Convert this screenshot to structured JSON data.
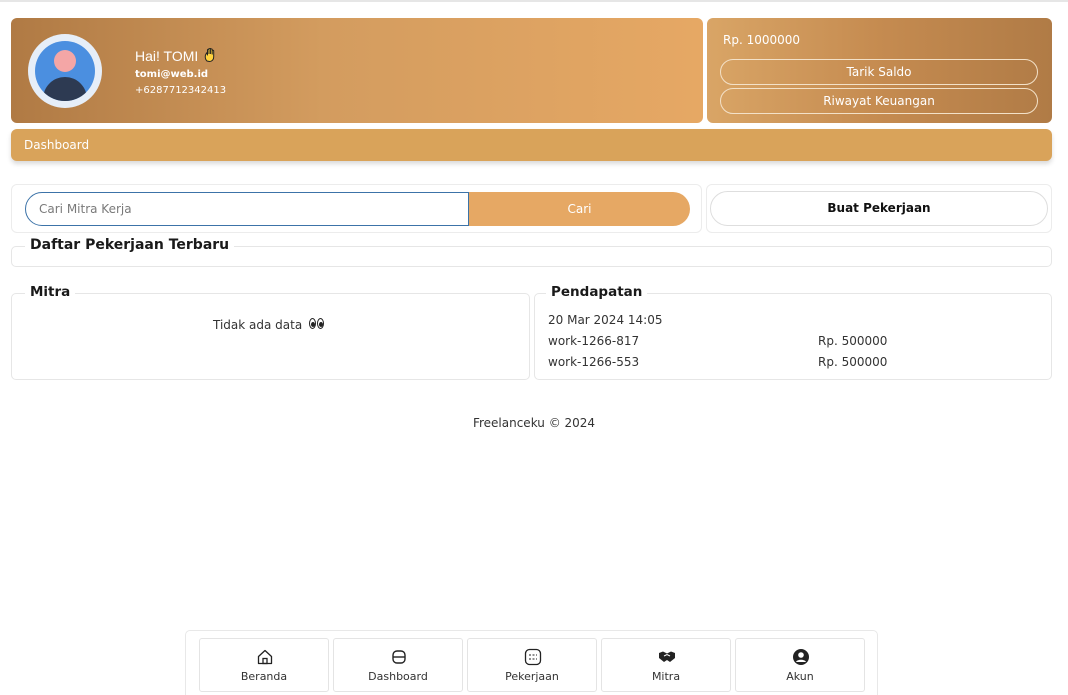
{
  "profile": {
    "greeting": "Hai! TOMI",
    "wave_icon": "waving-hand-icon",
    "email": "tomi@web.id",
    "phone": "+6287712342413"
  },
  "balance": {
    "amount": "Rp. 1000000",
    "withdraw_label": "Tarik Saldo",
    "history_label": "Riwayat Keuangan"
  },
  "breadcrumb": {
    "title": "Dashboard"
  },
  "search": {
    "placeholder": "Cari Mitra Kerja",
    "button_label": "Cari",
    "create_job_label": "Buat Pekerjaan"
  },
  "jobs": {
    "title": "Daftar Pekerjaan Terbaru"
  },
  "mitra": {
    "title": "Mitra",
    "empty_text": "Tidak ada data"
  },
  "income": {
    "title": "Pendapatan",
    "date": "20 Mar 2024 14:05",
    "rows": [
      {
        "work": "work-1266-817",
        "amount": "Rp. 500000"
      },
      {
        "work": "work-1266-553",
        "amount": "Rp. 500000"
      }
    ]
  },
  "footer": {
    "text": "Freelanceku © 2024"
  },
  "nav": [
    {
      "label": "Beranda",
      "icon": "home-icon"
    },
    {
      "label": "Dashboard",
      "icon": "dashboard-icon"
    },
    {
      "label": "Pekerjaan",
      "icon": "job-icon"
    },
    {
      "label": "Mitra",
      "icon": "handshake-icon"
    },
    {
      "label": "Akun",
      "icon": "account-icon"
    }
  ],
  "colors": {
    "brand_gold": "#d9a35a",
    "search_button": "#e6a864",
    "input_border": "#3c73a8"
  }
}
